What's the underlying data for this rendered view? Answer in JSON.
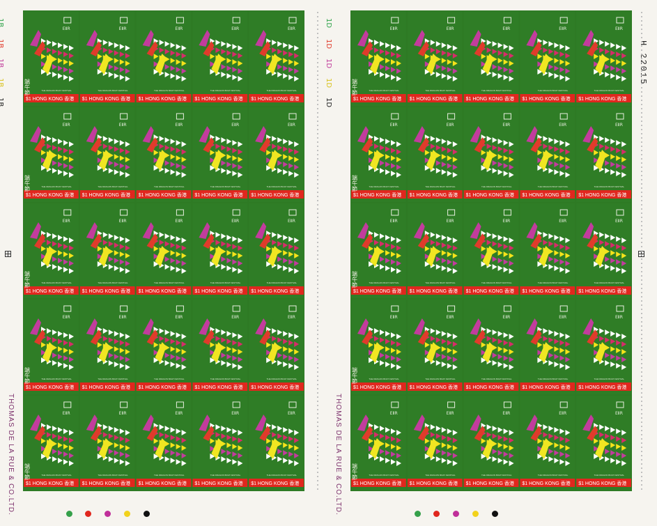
{
  "sheet": {
    "stamp_value_text": "$1 HONG KONG 香港",
    "stamp_caption": "THE DRAGON BOAT FESTIVAL",
    "stamp_cjk_vertical": "端午節",
    "monogram": "EⅡR",
    "plate_numbers_left": [
      "1B",
      "1B",
      "1B",
      "1B",
      "1B"
    ],
    "plate_numbers_right": [
      "1D",
      "1D",
      "1D",
      "1D",
      "1D"
    ],
    "imprint_text": "THOMAS DE LA RUE & CO.LTD.",
    "sheet_number": "H 22015",
    "color_dots": [
      "#35a04a",
      "#e0271e",
      "#c02f9a",
      "#f2d21c",
      "#111111"
    ]
  }
}
